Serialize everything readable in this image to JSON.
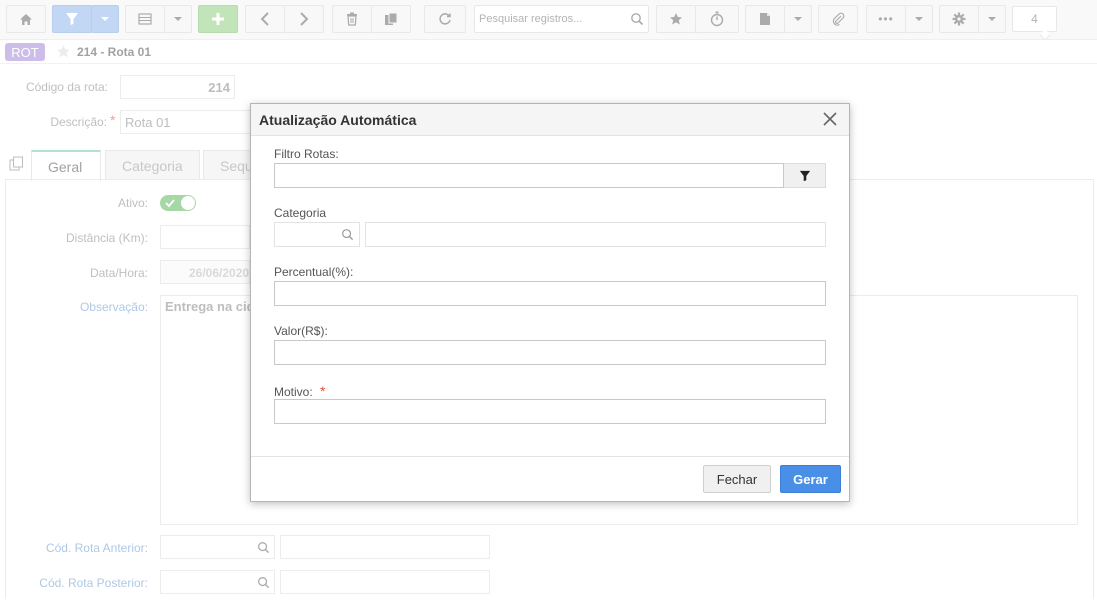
{
  "toolbar": {
    "search_placeholder": "Pesquisar registros...",
    "counter": "4"
  },
  "record": {
    "badge": "ROT",
    "title": "214 - Rota 01"
  },
  "form": {
    "codigo_label": "Código da rota:",
    "codigo_value": "214",
    "descricao_label": "Descrição:",
    "descricao_value": "Rota 01",
    "required_mark": "*"
  },
  "tabs": [
    {
      "label": "Geral"
    },
    {
      "label": "Categoria"
    },
    {
      "label": "Sequ"
    }
  ],
  "geral": {
    "ativo_label": "Ativo:",
    "ativo_on": true,
    "distancia_label": "Distância (Km):",
    "datahora_label": "Data/Hora:",
    "datahora_value": "26/06/2020",
    "observacao_label": "Observação:",
    "observacao_value": "Entrega na cid",
    "anterior_label": "Cód. Rota Anterior:",
    "posterior_label": "Cód. Rota Posterior:"
  },
  "modal": {
    "title": "Atualização Automática",
    "filtro_label": "Filtro Rotas:",
    "categoria_label": "Categoria",
    "percentual_label": "Percentual(%):",
    "valor_label": "Valor(R$):",
    "motivo_label": "Motivo:",
    "required_mark": "*",
    "close_label": "Fechar",
    "submit_label": "Gerar"
  },
  "colors": {
    "accent": "#4a8fe7",
    "badge": "#9b7fd4",
    "add": "#7fc96e",
    "toggle": "#5cb85c",
    "required": "#e74c3c"
  }
}
